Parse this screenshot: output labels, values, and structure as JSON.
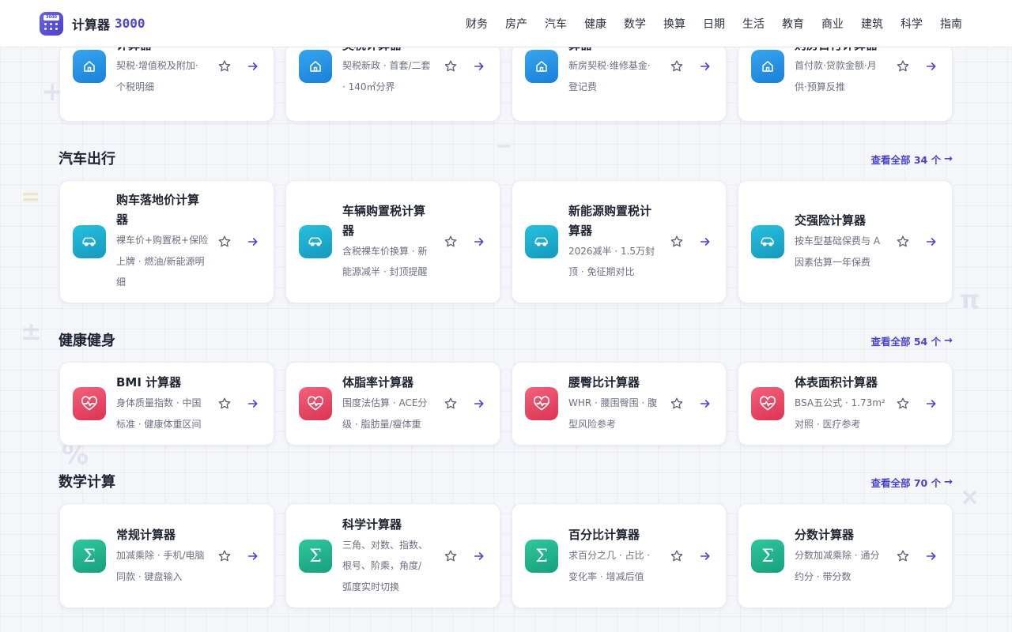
{
  "brand": {
    "name": "计算器",
    "number": "3000",
    "logo_screen": "3000"
  },
  "nav": [
    "财务",
    "房产",
    "汽车",
    "健康",
    "数学",
    "换算",
    "日期",
    "生活",
    "教育",
    "商业",
    "建筑",
    "科学",
    "指南"
  ],
  "decor": [
    "+",
    "=",
    "±",
    "−",
    "π",
    "%",
    "×"
  ],
  "colors": {
    "accent": "#4b43cf",
    "house": "#1a7fd9",
    "car": "#1499bd",
    "heart": "#dc3354",
    "sigma": "#16a07c"
  },
  "sections": [
    {
      "cards": [
        {
          "title": [
            "计算器"
          ],
          "desc": [
            "契税·增值税及附加·",
            "个税明细"
          ],
          "icon": "house-icon"
        },
        {
          "title": [
            "契税计算器"
          ],
          "desc": [
            "契税新政 · 首套/二套",
            "· 140㎡分界"
          ],
          "icon": "house-icon"
        },
        {
          "title": [
            "算器"
          ],
          "desc": [
            "新房契税·维修基金·",
            "登记费"
          ],
          "icon": "house-icon"
        },
        {
          "title": [
            "购房首付计算器"
          ],
          "desc": [
            "首付款·贷款金额·月",
            "供·预算反推"
          ],
          "icon": "house-icon"
        }
      ]
    },
    {
      "title": "汽车出行",
      "more": "查看全部 34 个",
      "cards": [
        {
          "title": [
            "购车落地价计算",
            "器"
          ],
          "desc": [
            "裸车价+购置税+保险",
            "上牌 · 燃油/新能源明",
            "细"
          ],
          "icon": "car-icon"
        },
        {
          "title": [
            "车辆购置税计算",
            "器"
          ],
          "desc": [
            "含税裸车价换算 · 新",
            "能源减半 · 封顶提醒"
          ],
          "icon": "car-icon"
        },
        {
          "title": [
            "新能源购置税计",
            "算器"
          ],
          "desc": [
            "2026减半 · 1.5万封",
            "顶 · 免征期对比"
          ],
          "icon": "car-icon"
        },
        {
          "title": [
            "交强险计算器"
          ],
          "desc": [
            "按车型基础保费与 A",
            "因素估算一年保费"
          ],
          "icon": "car-icon"
        }
      ]
    },
    {
      "title": "健康健身",
      "more": "查看全部 54 个",
      "cards": [
        {
          "title": [
            "BMI 计算器"
          ],
          "desc": [
            "身体质量指数 · 中国",
            "标准 · 健康体重区间"
          ],
          "icon": "heart-pulse-icon"
        },
        {
          "title": [
            "体脂率计算器"
          ],
          "desc": [
            "围度法估算 · ACE分",
            "级 · 脂肪量/瘦体重"
          ],
          "icon": "heart-pulse-icon"
        },
        {
          "title": [
            "腰臀比计算器"
          ],
          "desc": [
            "WHR · 腰围臀围 · 腹",
            "型风险参考"
          ],
          "icon": "heart-pulse-icon"
        },
        {
          "title": [
            "体表面积计算器"
          ],
          "desc": [
            "BSA五公式 · 1.73m²",
            "对照 · 医疗参考"
          ],
          "icon": "heart-pulse-icon"
        }
      ]
    },
    {
      "title": "数学计算",
      "more": "查看全部 70 个",
      "cards": [
        {
          "title": [
            "常规计算器"
          ],
          "desc": [
            "加减乘除 · 手机/电脑",
            "同款 · 键盘输入"
          ],
          "icon": "sigma-icon"
        },
        {
          "title": [
            "科学计算器"
          ],
          "desc": [
            "三角、对数、指数、",
            "根号、阶乘，角度/",
            "弧度实时切换"
          ],
          "icon": "sigma-icon"
        },
        {
          "title": [
            "百分比计算器"
          ],
          "desc": [
            "求百分之几 · 占比 ·",
            "变化率 · 增减后值"
          ],
          "icon": "sigma-icon"
        },
        {
          "title": [
            "分数计算器"
          ],
          "desc": [
            "分数加减乘除 · 通分",
            "约分 · 带分数"
          ],
          "icon": "sigma-icon"
        }
      ]
    }
  ]
}
